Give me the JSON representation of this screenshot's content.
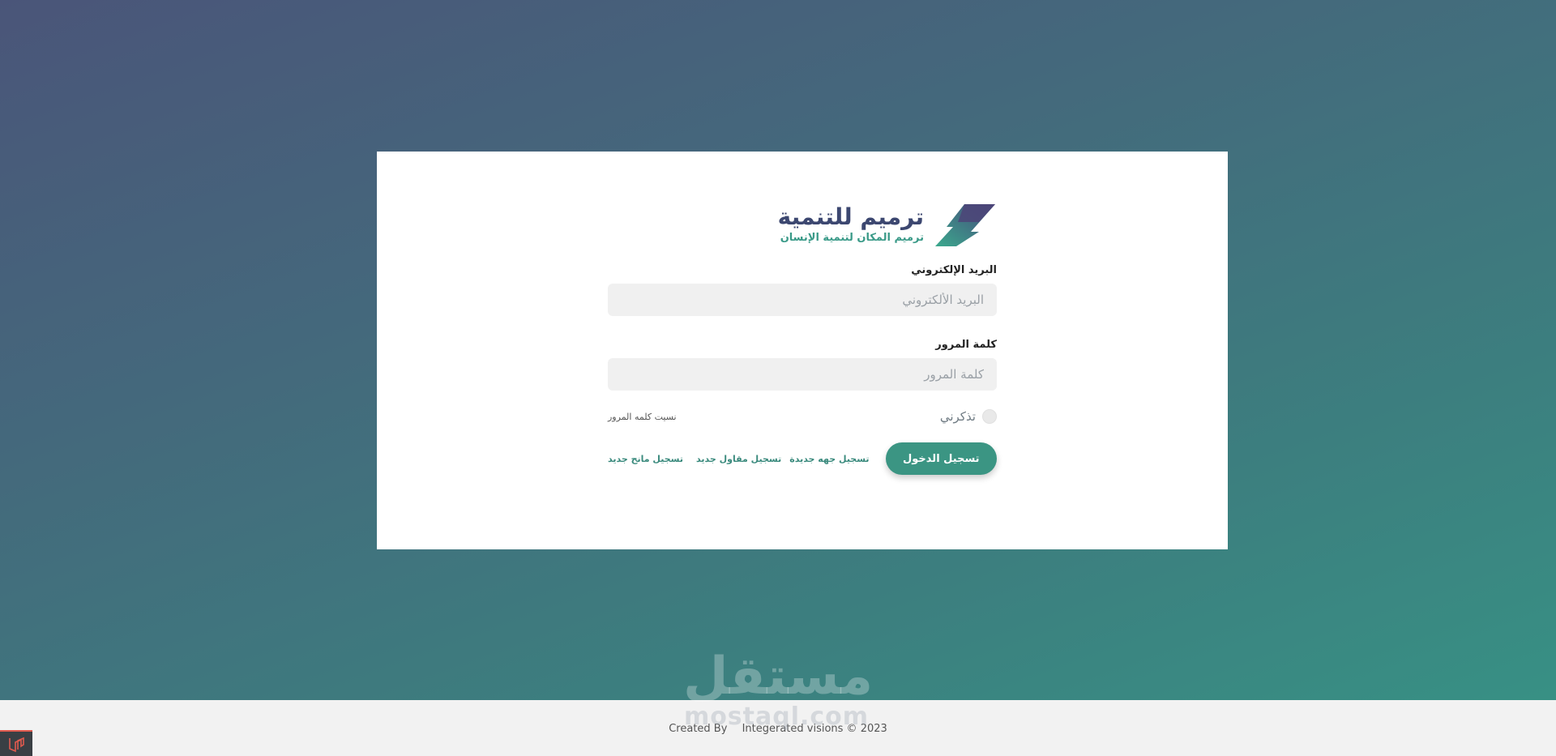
{
  "brand": {
    "title": "ترميم للتنمية",
    "subtitle": "ترميم المكان لتنمية الإنسان"
  },
  "form": {
    "email_label": "البريد الإلكتروني",
    "email_placeholder": "البريد الألكتروني",
    "email_value": "",
    "password_label": "كلمة المرور",
    "password_placeholder": "كلمة المرور",
    "password_value": "",
    "remember_label": "تذكرني",
    "remember_checked": false,
    "forgot_label": "نسيت كلمه المرور",
    "login_button": "تسجيل الدخول",
    "register_links": [
      "تسجيل جهه جديدة",
      "تسجيل مقاول جديد",
      "تسجيل مانح جديد"
    ]
  },
  "footer": {
    "created_by": "Created By",
    "brand": "Integerated visions © 2023"
  },
  "watermark": {
    "arabic": "مستقل",
    "latin": "mostaql.com"
  },
  "colors": {
    "primary": "#3b9583",
    "brand_dark": "#3c4770",
    "bg_top": "#4a5579",
    "bg_bottom": "#379385",
    "debug_badge": "#e05a4e"
  },
  "icons": {
    "logo": "ribbon-logo-icon",
    "debug": "laravel-icon"
  }
}
